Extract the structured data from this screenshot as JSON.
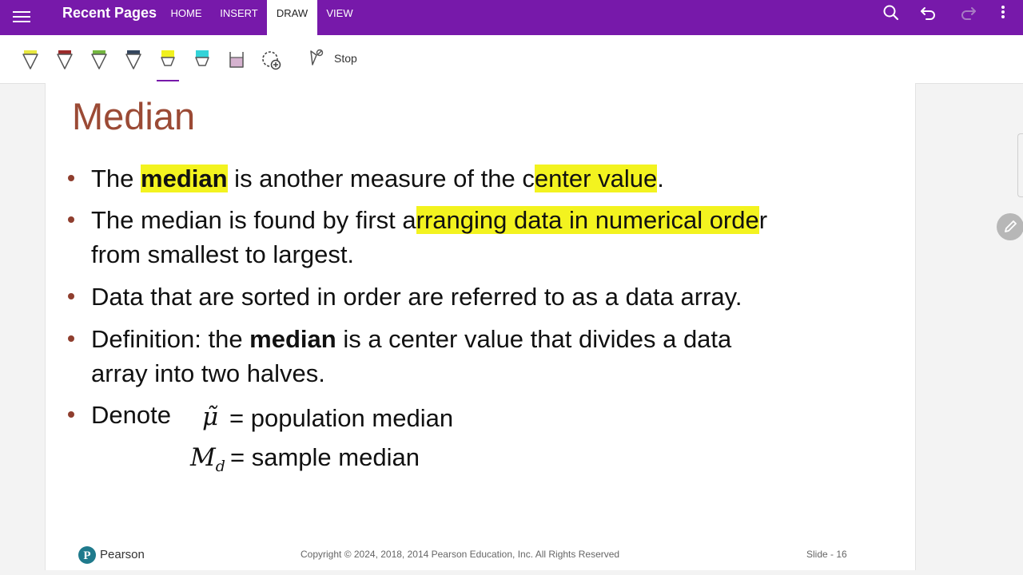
{
  "topbar": {
    "app_title": "Recent Pages",
    "tabs": [
      {
        "label": "HOME"
      },
      {
        "label": "INSERT"
      },
      {
        "label": "DRAW"
      },
      {
        "label": "VIEW"
      }
    ],
    "active_tab": "DRAW",
    "right_icons": [
      "search-icon",
      "undo-icon",
      "redo-icon",
      "more-vert-icon"
    ],
    "accent_color": "#7719aa"
  },
  "toolbar": {
    "tools": [
      {
        "name": "pen-yellow-icon",
        "color": "#e8e840"
      },
      {
        "name": "pen-red-icon",
        "color": "#9b2b2b"
      },
      {
        "name": "pen-green-icon",
        "color": "#74b640"
      },
      {
        "name": "pen-navy-icon",
        "color": "#34465e"
      },
      {
        "name": "highlighter-yellow-icon",
        "color": "#f1f11e"
      },
      {
        "name": "highlighter-cyan-icon",
        "color": "#34d3d8"
      },
      {
        "name": "highlighter-purple-icon",
        "color": "#d5b2cf"
      },
      {
        "name": "add-pen-icon",
        "color": "#444444"
      }
    ],
    "selected_tool": "highlighter-yellow-icon",
    "stop_label": "Stop"
  },
  "slide": {
    "title": "Median",
    "title_color": "#9b4a35",
    "highlight_color": "#f3f31f",
    "bullets": {
      "b1_pre": "The ",
      "b1_bold": "median",
      "b1_mid": " is another measure of the c",
      "b1_hl": "enter value",
      "b1_end": ".",
      "b2_pre": "The median is found by first a",
      "b2_hl": "rranging data in numerical orde",
      "b2_end": "r",
      "b2_line2": "from smallest to largest.",
      "b3": "Data that are sorted in order are referred to as a data array.",
      "b4_pre": "Definition: the ",
      "b4_bold": "median",
      "b4_end": " is a center value that divides a data",
      "b4_line2": "array into two halves.",
      "b5_label": "Denote",
      "pop_symbol": "μ̃",
      "pop_text": "= population median",
      "sample_symbol": "M",
      "sample_sub": "d",
      "sample_text": "= sample median"
    },
    "footer": {
      "brand": "Pearson",
      "copyright": "Copyright © 2024, 2018, 2014 Pearson Education, Inc. All Rights Reserved",
      "slide_number": "Slide - 16"
    }
  },
  "floating": {
    "pen_button_icon": "pencil-icon"
  }
}
